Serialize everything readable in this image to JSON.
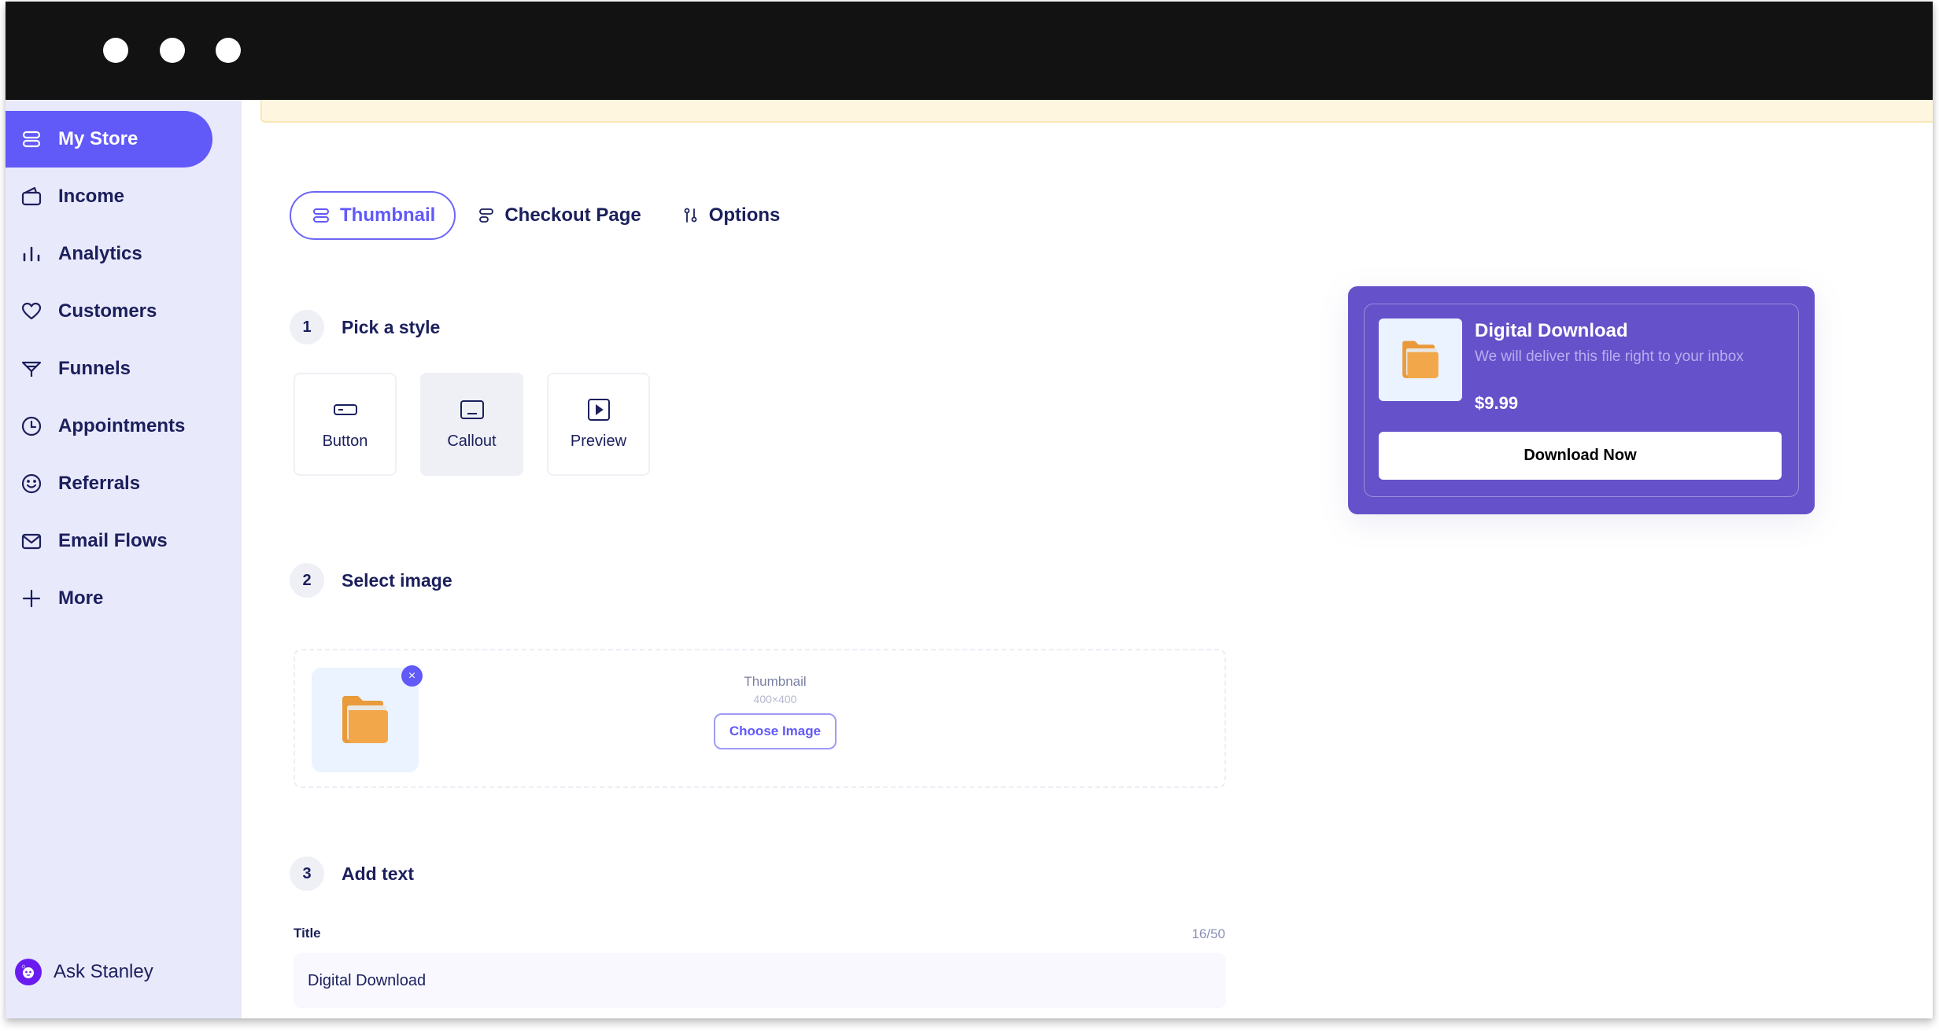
{
  "window": {
    "traffic_lights": [
      "dot",
      "dot",
      "dot"
    ]
  },
  "sidebar": {
    "items": [
      {
        "label": "My Store",
        "icon": "store-icon",
        "active": true
      },
      {
        "label": "Income",
        "icon": "wallet-icon",
        "active": false
      },
      {
        "label": "Analytics",
        "icon": "bar-chart-icon",
        "active": false
      },
      {
        "label": "Customers",
        "icon": "heart-icon",
        "active": false
      },
      {
        "label": "Funnels",
        "icon": "funnel-icon",
        "active": false
      },
      {
        "label": "Appointments",
        "icon": "clock-icon",
        "active": false
      },
      {
        "label": "Referrals",
        "icon": "smiley-icon",
        "active": false
      },
      {
        "label": "Email Flows",
        "icon": "mail-icon",
        "active": false
      },
      {
        "label": "More",
        "icon": "plus-icon",
        "active": false
      }
    ],
    "assistant_label": "Ask Stanley"
  },
  "tabs": [
    {
      "label": "Thumbnail",
      "icon": "store-icon",
      "active": true
    },
    {
      "label": "Checkout Page",
      "icon": "layout-icon",
      "active": false
    },
    {
      "label": "Options",
      "icon": "sliders-icon",
      "active": false
    }
  ],
  "steps": [
    {
      "number": "1",
      "title": "Pick a style"
    },
    {
      "number": "2",
      "title": "Select image"
    },
    {
      "number": "3",
      "title": "Add text"
    }
  ],
  "styles": [
    {
      "label": "Button",
      "icon": "button-icon",
      "selected": false
    },
    {
      "label": "Callout",
      "icon": "callout-icon",
      "selected": true
    },
    {
      "label": "Preview",
      "icon": "play-icon",
      "selected": false
    }
  ],
  "image_select": {
    "name": "Thumbnail",
    "size": "400×400",
    "choose_label": "Choose Image",
    "remove_symbol": "×"
  },
  "text_fields": {
    "title_label": "Title",
    "title_count": "16/50",
    "title_value": "Digital Download"
  },
  "preview": {
    "title": "Digital Download",
    "description": "We will deliver this file right to your inbox",
    "price": "$9.99",
    "button_label": "Download Now"
  },
  "colors": {
    "accent": "#6159F8",
    "sidebar_bg": "#E9E9FC",
    "preview_bg": "#6551C9",
    "banner_bg": "#FFF6E0",
    "text_dark": "#1B1F5C"
  }
}
